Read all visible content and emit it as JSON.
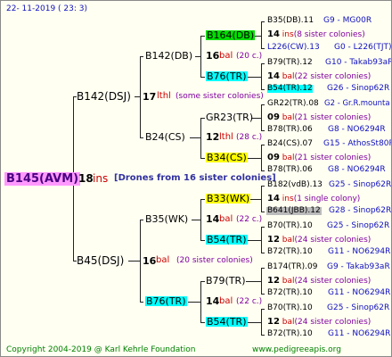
{
  "date": "22- 11-2019 ( 23:  3)",
  "root": {
    "id": "B145(AVM)",
    "num": "18",
    "ins": "ins",
    "note": "[Drones from 16 sister colonies]"
  },
  "gen1": [
    {
      "id": "B142(DSJ)",
      "num": "17",
      "code": "lthl",
      "note": "(some sister colonies)"
    },
    {
      "id": "B45(DSJ)",
      "num": "16",
      "code": "bal",
      "note": "(20 sister colonies)"
    }
  ],
  "gen2": [
    {
      "id": "B142(DB)",
      "num": "16",
      "code": "bal",
      "note": "(20 c.)"
    },
    {
      "id": "B24(CS)",
      "num": "12",
      "code": "lthl",
      "note": "(28 c.)"
    },
    {
      "id": "B35(WK)",
      "num": "14",
      "code": "bal",
      "note": "(22 c.)"
    },
    {
      "id": "B76(TR)",
      "num": "14",
      "code": "bal",
      "note": "(22 c.)"
    }
  ],
  "gen3": [
    {
      "id": "B164(DB)",
      "num": "14",
      "code": "ins",
      "note": "(8 sister colonies)"
    },
    {
      "id": "B76(TR)",
      "num": "14",
      "code": "bal",
      "note": "(22 sister colonies)"
    },
    {
      "id": "GR23(TR)",
      "num": "09",
      "code": "bal",
      "note": "(21 sister colonies)"
    },
    {
      "id": "B34(CS)",
      "num": "09",
      "code": "bal",
      "note": "(21 sister colonies)"
    },
    {
      "id": "B33(WK)",
      "num": "14",
      "code": "ins",
      "note": "(1 single colony)"
    },
    {
      "id": "B54(TR)",
      "num": "12",
      "code": "bal",
      "note": "(24 sister colonies)"
    },
    {
      "id": "B79(TR)",
      "num": "12",
      "code": "bal",
      "note": "(24 sister colonies)"
    },
    {
      "id": "B54(TR)",
      "num": "12",
      "code": "bal",
      "note": "(24 sister colonies)"
    }
  ],
  "gen4": [
    {
      "id": "B35(DB).11",
      "gen": "G9 - MG00R"
    },
    {
      "id": "L226(CW).13",
      "gen": "G0 - L226(TJT)"
    },
    {
      "id": "B79(TR).12",
      "gen": "G10 - Takab93aR"
    },
    {
      "id": "B54(TR).12",
      "gen": "G26 - Sinop62R"
    },
    {
      "id": "GR22(TR).08",
      "gen": "G2 - Gr.R.mounta"
    },
    {
      "id": "B78(TR).06",
      "gen": "G8 - NO6294R"
    },
    {
      "id": "B24(CS).07",
      "gen": "G15 - AthosSt80R"
    },
    {
      "id": "B78(TR).06",
      "gen": "G8 - NO6294R"
    },
    {
      "id": "B182(vdB).13",
      "gen": "G25 - Sinop62R"
    },
    {
      "id": "B641(JBB).12",
      "gen": "G28 - Sinop62R"
    },
    {
      "id": "B70(TR).10",
      "gen": "G25 - Sinop62R"
    },
    {
      "id": "B72(TR).10",
      "gen": "G11 - NO6294R"
    },
    {
      "id": "B174(TR).09",
      "gen": "G9 - Takab93aR"
    },
    {
      "id": "B72(TR).10",
      "gen": "G11 - NO6294R"
    },
    {
      "id": "B70(TR).10",
      "gen": "G25 - Sinop62R"
    },
    {
      "id": "B72(TR).10",
      "gen": "G11 - NO6294R"
    }
  ],
  "footer": {
    "copyright": "Copyright 2004-2019 @ Karl Kehrle Foundation",
    "site": "www.pedigreeapis.org"
  },
  "colors": {
    "root": "#ff99ff",
    "green": "#00dd00",
    "cyan": "#00ffff",
    "yellow": "#ffff00",
    "gray": "#bbbbbb"
  }
}
